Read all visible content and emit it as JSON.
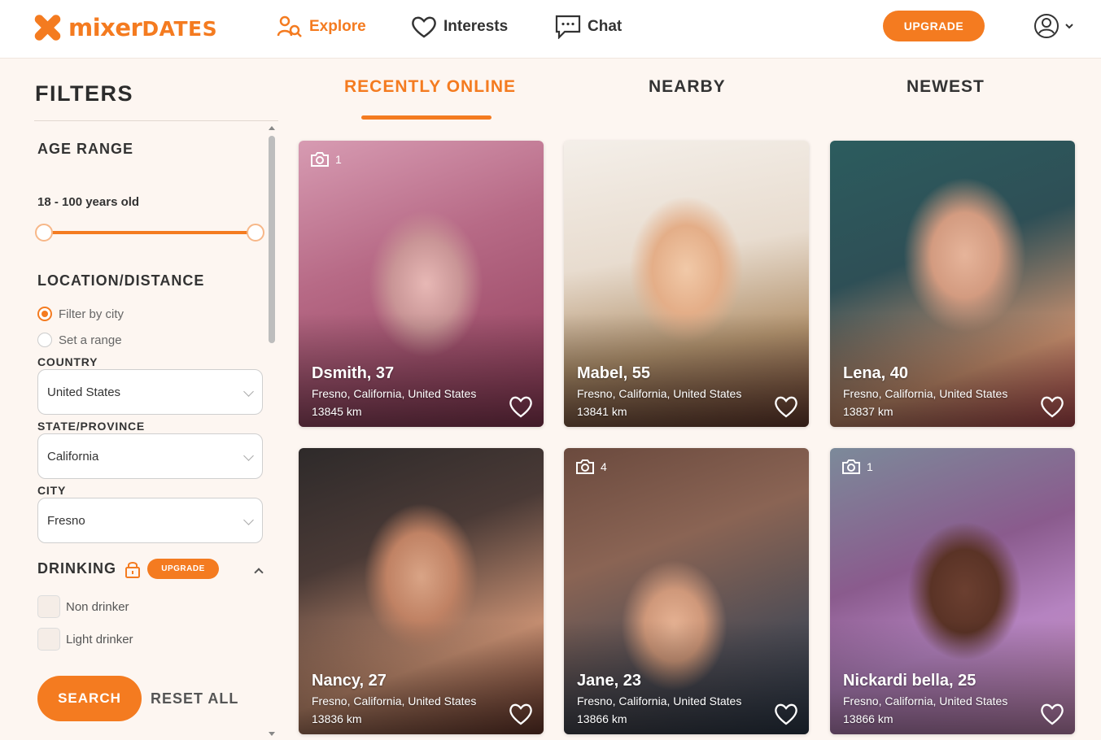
{
  "header": {
    "logo_main": "mixer",
    "logo_sub": "DATES",
    "nav": [
      {
        "label": "Explore",
        "icon": "explore-icon"
      },
      {
        "label": "Interests",
        "icon": "heart-icon"
      },
      {
        "label": "Chat",
        "icon": "chat-icon"
      }
    ],
    "upgrade_label": "UPGRADE",
    "accent_color": "#f47b20"
  },
  "sidebar": {
    "title": "FILTERS",
    "age": {
      "title": "AGE RANGE",
      "value": "18 - 100 years old",
      "min": 18,
      "max": 100
    },
    "location": {
      "title": "LOCATION/DISTANCE",
      "options": [
        "Filter by city",
        "Set a range"
      ],
      "selected": "Filter by city",
      "country_label": "COUNTRY",
      "country_value": "United States",
      "state_label": "STATE/PROVINCE",
      "state_value": "California",
      "city_label": "CITY",
      "city_value": "Fresno"
    },
    "drinking": {
      "title": "DRINKING",
      "upgrade_label": "UPGRADE",
      "options": [
        "Non drinker",
        "Light drinker"
      ]
    },
    "search_label": "SEARCH",
    "reset_label": "RESET ALL"
  },
  "tabs": [
    {
      "label": "RECENTLY ONLINE",
      "active": true
    },
    {
      "label": "NEARBY",
      "active": false
    },
    {
      "label": "NEWEST",
      "active": false
    }
  ],
  "profiles": [
    {
      "name": "Dsmith, 37",
      "location": "Fresno, California, United States",
      "distance": "13845 km",
      "photos": "1"
    },
    {
      "name": "Mabel, 55",
      "location": "Fresno, California, United States",
      "distance": "13841 km",
      "photos": ""
    },
    {
      "name": "Lena, 40",
      "location": "Fresno, California, United States",
      "distance": "13837 km",
      "photos": ""
    },
    {
      "name": "Nancy, 27",
      "location": "Fresno, California, United States",
      "distance": "13836 km",
      "photos": ""
    },
    {
      "name": "Jane, 23",
      "location": "Fresno, California, United States",
      "distance": "13866 km",
      "photos": "4"
    },
    {
      "name": "Nickardi bella, 25",
      "location": "Fresno, California, United States",
      "distance": "13866 km",
      "photos": "1"
    }
  ]
}
